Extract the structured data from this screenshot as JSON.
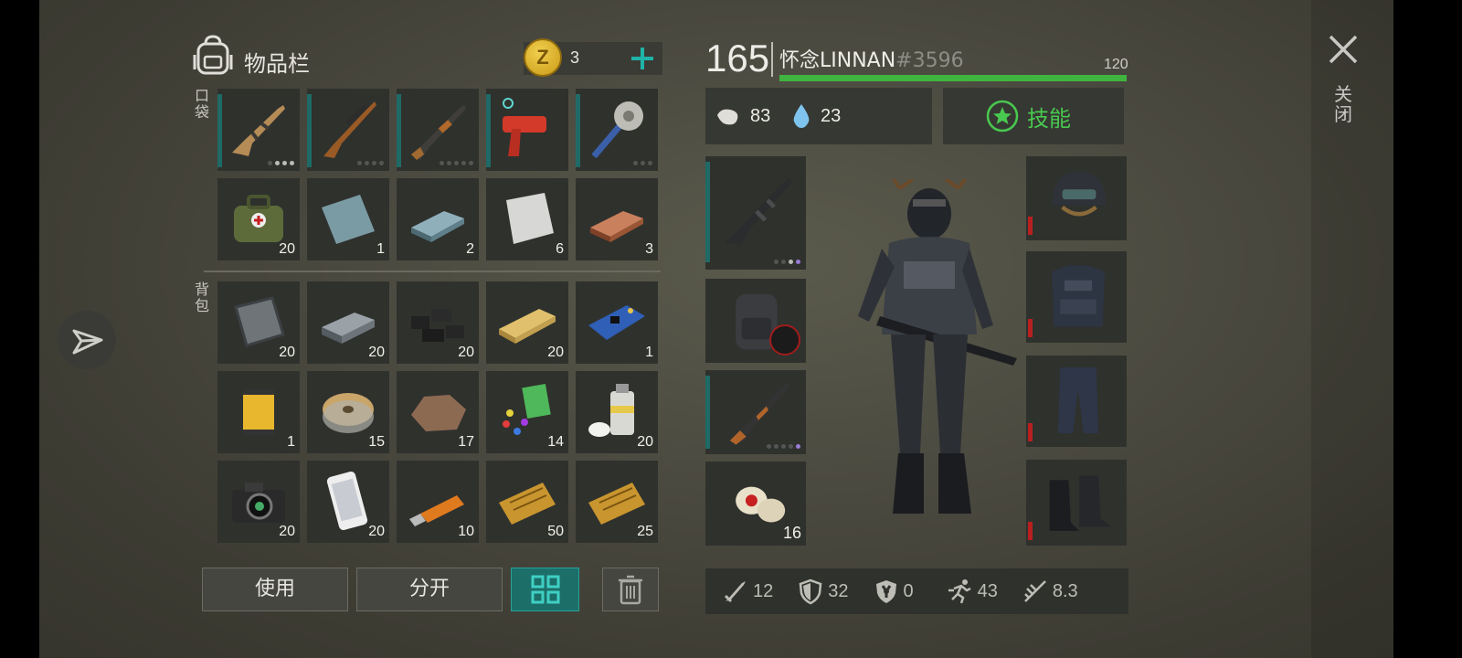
{
  "inventory": {
    "title": "物品栏",
    "coins": "3",
    "pocket_label": "口袋",
    "backpack_label": "背包",
    "pocket_items": [
      {
        "icon": "rifle-scar-icon",
        "count": ""
      },
      {
        "icon": "rifle-svd-icon",
        "count": ""
      },
      {
        "icon": "shotgun-icon",
        "count": ""
      },
      {
        "icon": "flare-gun-icon",
        "count": ""
      },
      {
        "icon": "saw-mace-icon",
        "count": ""
      },
      {
        "icon": "medkit-bag-icon",
        "count": "20"
      },
      {
        "icon": "metal-plate-icon",
        "count": "1"
      },
      {
        "icon": "steel-ingot-icon",
        "count": "2"
      },
      {
        "icon": "aluminum-sheet-icon",
        "count": "6"
      },
      {
        "icon": "copper-ingot-icon",
        "count": "3"
      }
    ],
    "backpack_items": [
      {
        "icon": "iron-plate-icon",
        "count": "20"
      },
      {
        "icon": "iron-bar-icon",
        "count": "20"
      },
      {
        "icon": "coal-icon",
        "count": "20"
      },
      {
        "icon": "wood-plank-icon",
        "count": "20"
      },
      {
        "icon": "circuit-board-icon",
        "count": "1"
      },
      {
        "icon": "filter-icon",
        "count": "1"
      },
      {
        "icon": "wire-spool-icon",
        "count": "15"
      },
      {
        "icon": "ore-rock-icon",
        "count": "17"
      },
      {
        "icon": "plastic-pellets-icon",
        "count": "14"
      },
      {
        "icon": "spray-paint-icon",
        "count": "20"
      },
      {
        "icon": "camera-icon",
        "count": "20"
      },
      {
        "icon": "smartphone-icon",
        "count": "20"
      },
      {
        "icon": "usb-drive-icon",
        "count": "10"
      },
      {
        "icon": "coupon-icon",
        "count": "50"
      },
      {
        "icon": "coupon-icon",
        "count": "25"
      }
    ],
    "buttons": {
      "use": "使用",
      "split": "分开"
    }
  },
  "player": {
    "level": "165",
    "name": "怀念LINNAN",
    "tag": "#3596",
    "health": "120",
    "food": "83",
    "water": "23",
    "skills_label": "技能",
    "ammo_count": "16"
  },
  "stats": {
    "attack": "12",
    "armor": "32",
    "radiation": "0",
    "speed": "43",
    "weight": "8.3"
  },
  "close_label": "关闭",
  "colors": {
    "health": "#3fb53f",
    "accent": "#1aa39a",
    "skill": "#49c84f"
  }
}
